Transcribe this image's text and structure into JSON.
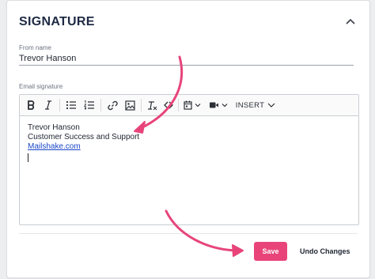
{
  "panel": {
    "title": "SIGNATURE"
  },
  "from_name": {
    "label": "From name",
    "value": "Trevor Hanson"
  },
  "email_signature": {
    "label": "Email signature",
    "toolbar": {
      "items": [
        "bold-icon",
        "italic-icon",
        "bulleted-list-icon",
        "numbered-list-icon",
        "link-icon",
        "image-icon",
        "clear-formatting-icon",
        "code-icon",
        "calendar-icon",
        "video-icon"
      ],
      "insert_label": "INSERT"
    },
    "content": {
      "line1": "Trevor Hanson",
      "line2": "Customer Success and Support",
      "link": "Mailshake.com"
    }
  },
  "actions": {
    "save_label": "Save",
    "undo_label": "Undo Changes"
  },
  "colors": {
    "accent": "#e8447a",
    "link": "#1a46c8",
    "title": "#1e2a44"
  }
}
